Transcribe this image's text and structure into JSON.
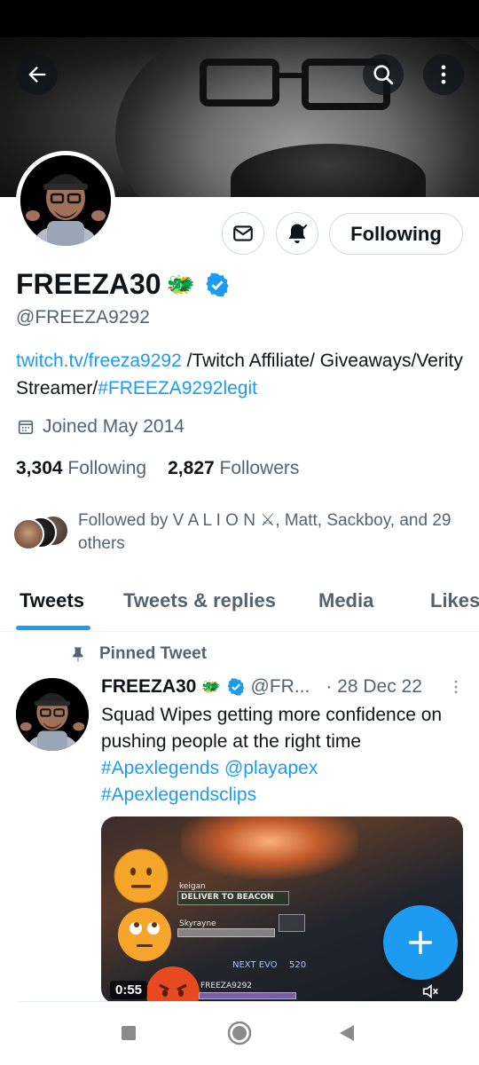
{
  "profile": {
    "display_name": "FREEZA30",
    "name_emoji": "🐲",
    "handle": "@FREEZA9292",
    "bio_link": "twitch.tv/freeza9292",
    "bio_text": " /Twitch Affiliate/ Giveaways/Verity Streamer/",
    "bio_hashtag": "#FREEZA9292legit",
    "joined": "Joined May 2014",
    "following_count": "3,304",
    "following_label": "Following",
    "followers_count": "2,827",
    "followers_label": "Followers",
    "followed_by": "Followed by V A L I O N ⚔, Matt, Sackboy, and 29 others",
    "follow_button_label": "Following"
  },
  "tabs": [
    {
      "label": "Tweets",
      "active": true
    },
    {
      "label": "Tweets & replies",
      "active": false
    },
    {
      "label": "Media",
      "active": false
    },
    {
      "label": "Likes",
      "active": false
    }
  ],
  "pinned_tweet": {
    "pinned_label": "Pinned Tweet",
    "user_name": "FREEZA30",
    "name_emoji": "🐲",
    "handle_short": "@FR...",
    "date": "· 28 Dec 22",
    "text": "Squad Wipes getting more confidence on pushing people at the right time",
    "hashtag1": "#Apexlegends",
    "mention": "@playapex",
    "hashtag2": "#Apexlegendsclips",
    "video": {
      "duration": "0:55",
      "hud_player1": "keigan",
      "hud_objective": "DELIVER TO BEACON",
      "hud_player2": "Skyrayne",
      "hud_next_evo": "NEXT EVO",
      "hud_evo_value": "520",
      "hud_player3": "FREEZA9292"
    }
  },
  "colors": {
    "accent": "#1d9bf0",
    "text_primary": "#0f1419",
    "text_secondary": "#536471"
  },
  "icons": {
    "back": "arrow-left-icon",
    "search": "search-icon",
    "more": "more-vertical-icon",
    "message": "mail-icon",
    "notify": "bell-check-icon",
    "verified": "verified-badge-icon",
    "calendar": "calendar-icon",
    "pin": "pin-icon",
    "compose": "plus-icon",
    "mute": "speaker-muted-icon"
  }
}
